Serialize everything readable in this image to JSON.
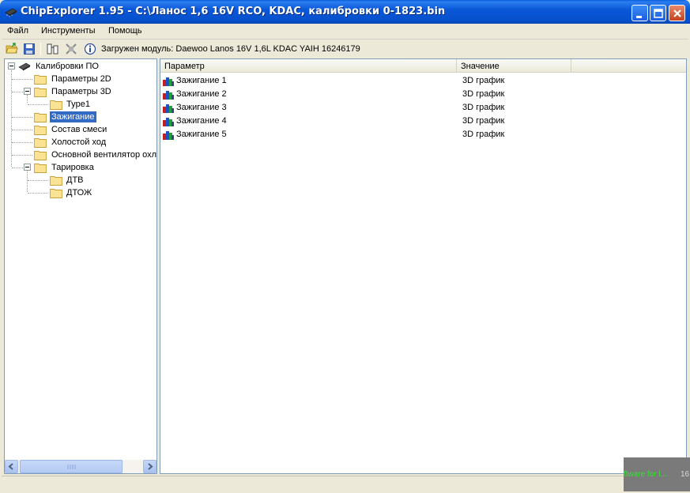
{
  "window": {
    "title": "ChipExplorer  1.95 - C:\\Ланос 1,6 16V RCO, KDAC, калибровки 0-1823.bin",
    "icon": "chip-icon"
  },
  "menu": {
    "file": "Файл",
    "tools": "Инструменты",
    "help": "Помощь"
  },
  "toolbar": {
    "module_label": "Загружен модуль: Daewoo Lanos 16V 1,6L KDAC YAIH 16246179"
  },
  "tree": {
    "root": "Калибровки ПО",
    "items": [
      {
        "label": "Параметры 2D"
      },
      {
        "label": "Параметры 3D"
      },
      {
        "label": "Type1"
      },
      {
        "label": "Зажигание"
      },
      {
        "label": "Состав смеси"
      },
      {
        "label": "Холостой ход"
      },
      {
        "label": "Основной вентилятор охлаждения"
      },
      {
        "label": "Тарировка"
      },
      {
        "label": "ДТВ"
      },
      {
        "label": "ДТОЖ"
      }
    ],
    "selected": "Зажигание"
  },
  "list": {
    "columns": [
      "Параметр",
      "Значение"
    ],
    "rows": [
      {
        "name": "Зажигание 1",
        "value": "3D график"
      },
      {
        "name": "Зажигание 2",
        "value": "3D график"
      },
      {
        "name": "Зажигание 3",
        "value": "3D график"
      },
      {
        "name": "Зажигание 4",
        "value": "3D график"
      },
      {
        "name": "Зажигание 5",
        "value": "3D график"
      }
    ]
  },
  "overlay": {
    "text": "ftware for l...",
    "number": "16"
  },
  "colors": {
    "titlebar": "#0a58d8",
    "selection": "#316ac5",
    "overlay_text": "#3cdc3c"
  }
}
